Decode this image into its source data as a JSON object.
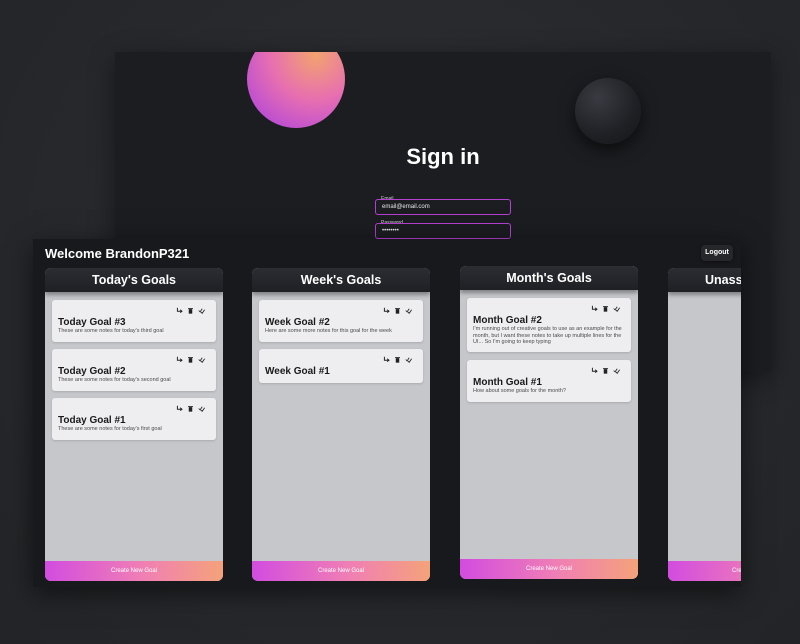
{
  "signin": {
    "title": "Sign in",
    "email_label": "Email",
    "email_value": "email@email.com",
    "password_label": "Password",
    "password_value": "••••••••"
  },
  "dashboard": {
    "welcome": "Welcome BrandonP321",
    "logout_label": "Logout",
    "columns": [
      {
        "title": "Today's Goals",
        "create_label": "Create New Goal",
        "goals": [
          {
            "title": "Today Goal #3",
            "notes": "These are some notes for today's third goal"
          },
          {
            "title": "Today Goal #2",
            "notes": "These are some notes for today's second goal"
          },
          {
            "title": "Today Goal #1",
            "notes": "These are some notes for today's first goal"
          }
        ]
      },
      {
        "title": "Week's Goals",
        "create_label": "Create New Goal",
        "goals": [
          {
            "title": "Week Goal #2",
            "notes": "Here are some more notes for this goal for the week"
          },
          {
            "title": "Week Goal #1",
            "notes": ""
          }
        ]
      },
      {
        "title": "Month's Goals",
        "create_label": "Create New Goal",
        "goals": [
          {
            "title": "Month Goal #2",
            "notes": "I'm running out of creative goals to use as an example for the month, but I want these notes to take up multiple lines for the UI... So I'm going to keep typing"
          },
          {
            "title": "Month Goal #1",
            "notes": "How about some goals for the month?"
          }
        ]
      },
      {
        "title": "Unass",
        "create_label": "Cre",
        "goals": []
      }
    ],
    "card_icons": [
      "move-icon",
      "trash-icon",
      "complete-icon"
    ]
  }
}
